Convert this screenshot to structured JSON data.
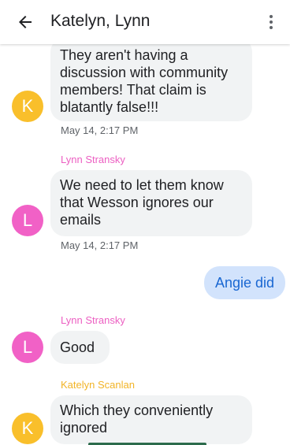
{
  "header": {
    "title": "Katelyn, Lynn",
    "back_icon": "arrow-back-icon",
    "menu_icon": "more-vert-icon"
  },
  "colors": {
    "katelyn_avatar": "#f9bf2b",
    "lynn_avatar": "#f161c6",
    "lynn_name": "#ec5fc2",
    "katelyn_name": "#f2b427",
    "outgoing_bubble": "#d2e3fc",
    "outgoing_text": "#1967d2",
    "incoming_bubble": "#f1f3f4"
  },
  "messages": [
    {
      "sender": "",
      "avatar": "K",
      "lines": [
        "They aren't having a",
        "discussion with community",
        "members! That claim is",
        "blatantly false!!!"
      ],
      "timestamp": "May 14, 2:17 PM"
    },
    {
      "sender": "Lynn Stransky",
      "avatar": "L",
      "lines": [
        "We need to let them know",
        "that Wesson ignores our",
        "emails"
      ],
      "timestamp": "May 14, 2:17 PM"
    },
    {
      "outgoing": true,
      "text": "Angie did"
    },
    {
      "sender": "Lynn Stransky",
      "avatar": "L",
      "lines": [
        "Good"
      ]
    },
    {
      "sender": "Katelyn Scanlan",
      "avatar": "K",
      "lines": [
        "Which they conveniently",
        "ignored"
      ]
    }
  ]
}
